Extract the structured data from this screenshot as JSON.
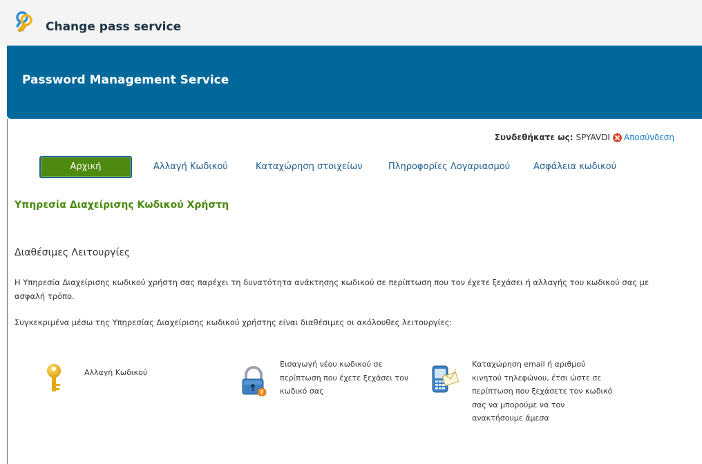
{
  "app": {
    "title": "Change pass service",
    "logo_icon": "key-logo-icon"
  },
  "banner": {
    "title": "Password Management Service"
  },
  "session": {
    "label": "Συνδεθήκατε ως:",
    "username": "SPYAVDI",
    "logout_label": "Αποσύνδεση"
  },
  "nav": {
    "items": [
      {
        "label": "Αρχική",
        "active": true
      },
      {
        "label": "Αλλαγή Κωδικού",
        "active": false
      },
      {
        "label": "Καταχώρηση στοιχείων",
        "active": false
      },
      {
        "label": "Πληροφορίες Λογαριασμού",
        "active": false
      },
      {
        "label": "Ασφάλεια κωδικού",
        "active": false
      }
    ]
  },
  "main": {
    "page_title": "Υπηρεσία Διαχείρισης Κωδικού Χρήστη",
    "section_title": "Διαθέσιμες Λειτουργίες",
    "intro": "Η Υπηρεσία Διαχείρισης κωδικού χρήστη σας παρέχει τη δυνατότητα ανάκτησης κωδικού σε περίπτωση που τον έχετε ξεχάσει ή αλλαγής του κωδικού σας με ασφαλή τρόπο.",
    "features_intro": "Συγκεκριμένα μέσω της Υπηρεσίας Διαχείρισης κωδικού χρήστης είναι διαθέσιμες οι ακόλουθες λειτουργίες:",
    "features": [
      {
        "icon": "golden-key-icon",
        "text": "Αλλαγή Κωδικού"
      },
      {
        "icon": "padlock-icon",
        "text": "Εισαγωγή νέου κωδικού σε περίπτωση που έχετε ξεχάσει τον κωδικό σας"
      },
      {
        "icon": "phone-email-icon",
        "text": "Καταχώρηση email ή αριθμού κινητού τηλεφώνου, έτσι ώστε σε περίπτωση που ξεχάσετε τον κωδικό σας να μπορούμε να τον ανακτήσουμε άμεσα"
      }
    ]
  },
  "colors": {
    "banner": "#01689b",
    "active_tab": "#4f8a10",
    "page_title": "#4a8a10",
    "link": "#1a7fc9"
  }
}
